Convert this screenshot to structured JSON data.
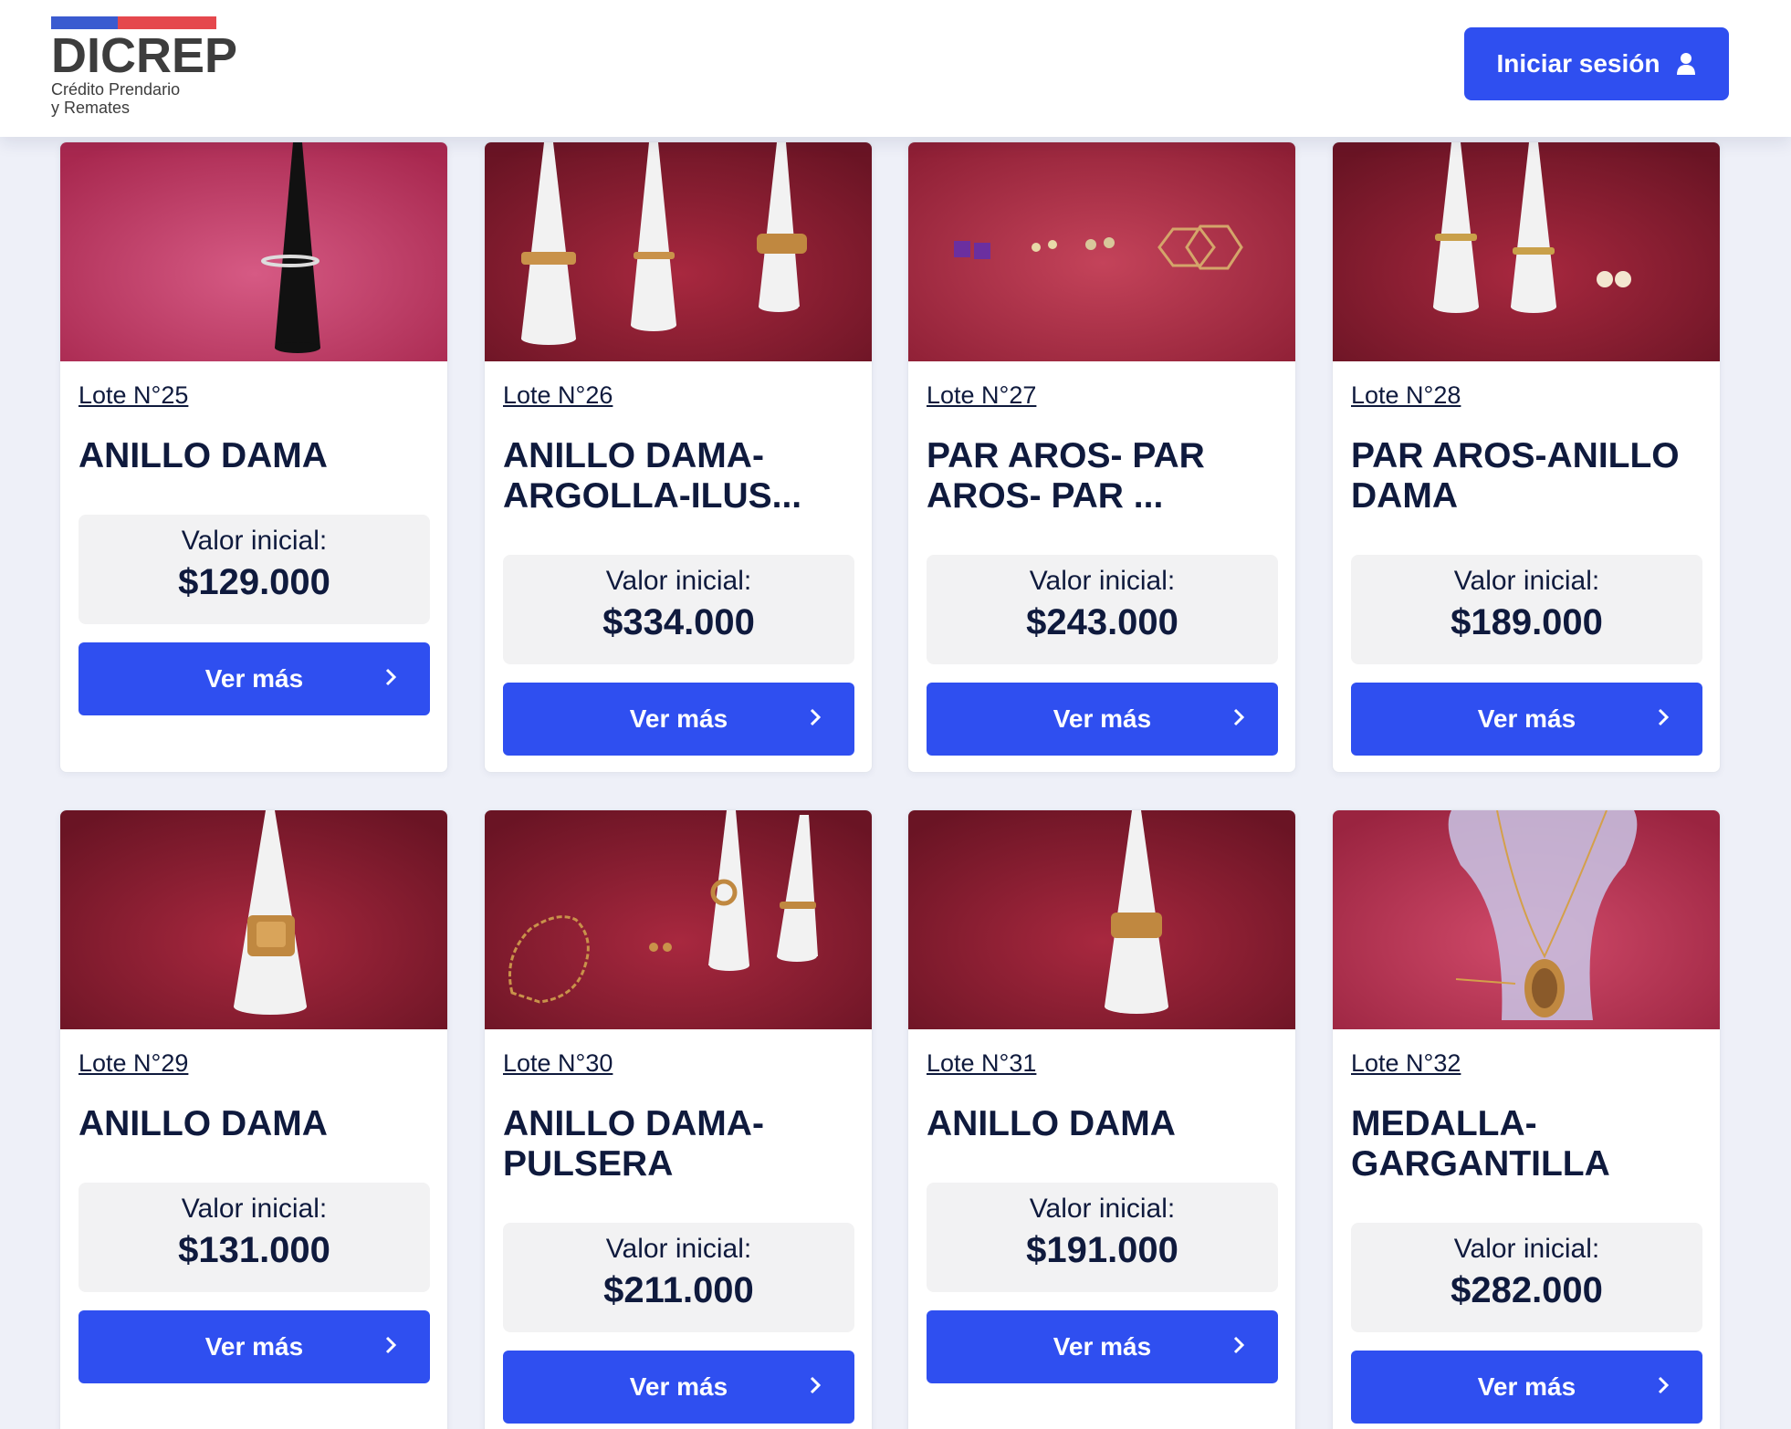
{
  "header": {
    "logo_word": "DICREP",
    "logo_sub_line1": "Crédito Prendario",
    "logo_sub_line2": "y Remates",
    "login_label": "Iniciar sesión"
  },
  "colors": {
    "primary": "#2f4ff0",
    "logo_blue": "#3a5bd0",
    "logo_red": "#e5484d",
    "text_dark": "#0f1a3d"
  },
  "common": {
    "value_label": "Valor inicial:",
    "more_label": "Ver más"
  },
  "lots": [
    {
      "lot": "Lote N°25",
      "title": "ANILLO DAMA",
      "price": "$129.000",
      "photo": "black-cone-single-ring"
    },
    {
      "lot": "Lote N°26",
      "title": "ANILLO DAMA-ARGOLLA-ILUS...",
      "price": "$334.000",
      "photo": "three-white-cones-rings"
    },
    {
      "lot": "Lote N°27",
      "title": "PAR AROS- PAR AROS- PAR ...",
      "price": "$243.000",
      "photo": "earrings-and-hoops"
    },
    {
      "lot": "Lote N°28",
      "title": "PAR AROS-ANILLO DAMA",
      "price": "$189.000",
      "photo": "two-cones-rings-pearls"
    },
    {
      "lot": "Lote N°29",
      "title": "ANILLO DAMA",
      "price": "$131.000",
      "photo": "white-cone-signet-ring"
    },
    {
      "lot": "Lote N°30",
      "title": "ANILLO DAMA-PULSERA",
      "price": "$211.000",
      "photo": "bracelet-earrings-rings"
    },
    {
      "lot": "Lote N°31",
      "title": "ANILLO DAMA",
      "price": "$191.000",
      "photo": "white-cone-band-ring"
    },
    {
      "lot": "Lote N°32",
      "title": "MEDALLA-GARGANTILLA",
      "price": "$282.000",
      "photo": "necklace-medal-stand"
    }
  ]
}
